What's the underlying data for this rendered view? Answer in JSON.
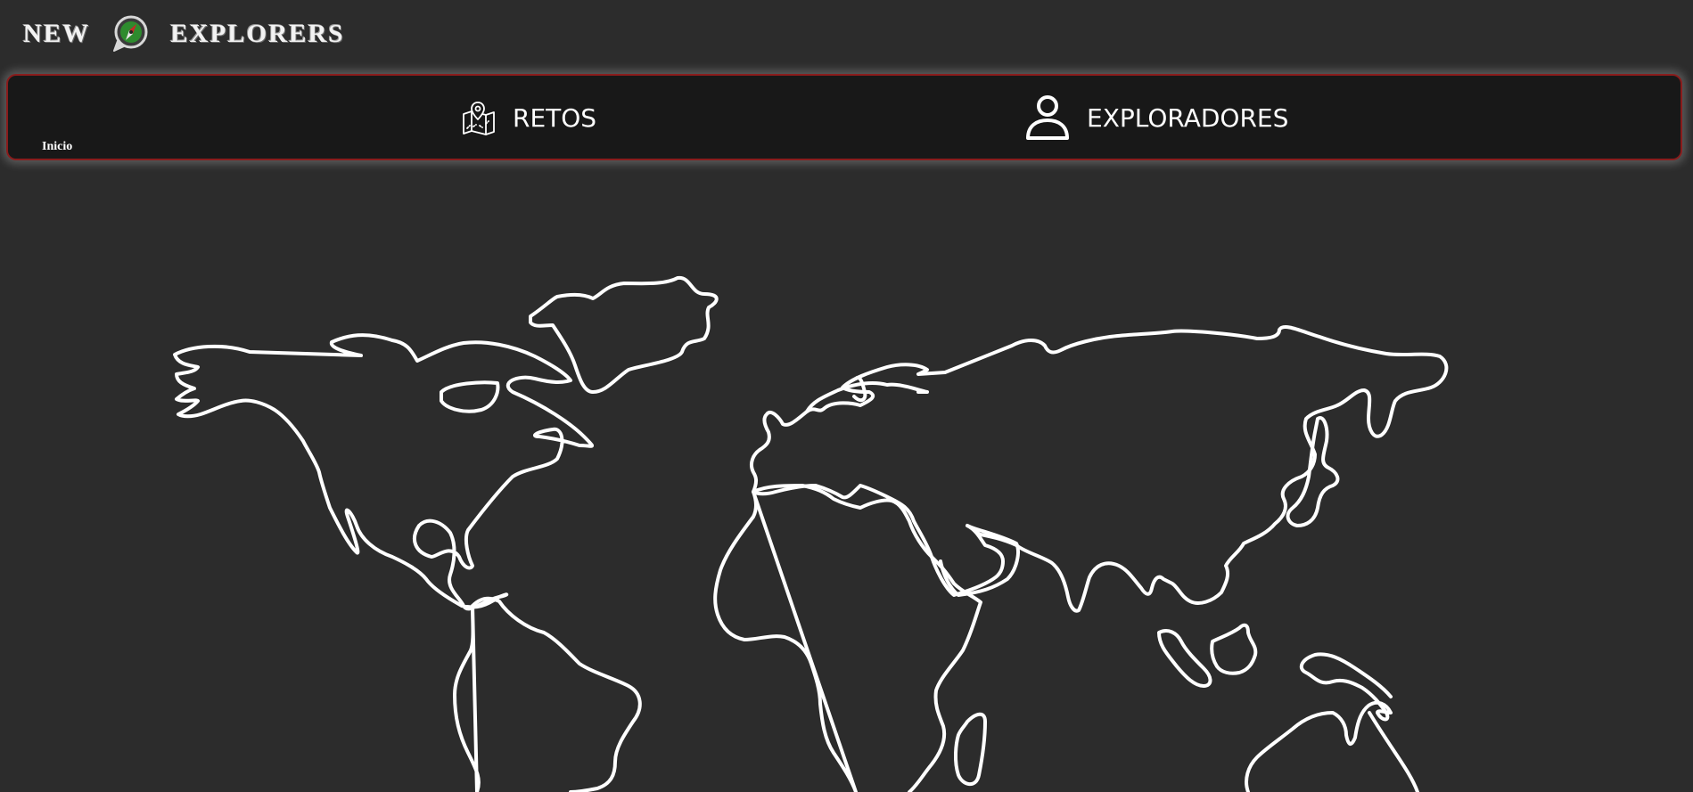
{
  "header": {
    "brand_left": "NEW",
    "brand_right": "EXPLORERS",
    "logo_icon": "compass-logo-icon"
  },
  "nav": {
    "home_label": "Inicio",
    "items": [
      {
        "label": "RETOS",
        "icon": "map-pin-icon"
      },
      {
        "label": "EXPLORADORES",
        "icon": "user-icon"
      }
    ]
  },
  "colors": {
    "background": "#2c2c2c",
    "navbar": "#181818",
    "navbar_border": "#8a1c1c",
    "map_stroke": "#ffffff",
    "logo_green": "#2e8b2e"
  },
  "main": {
    "illustration": "world-map-outline"
  }
}
